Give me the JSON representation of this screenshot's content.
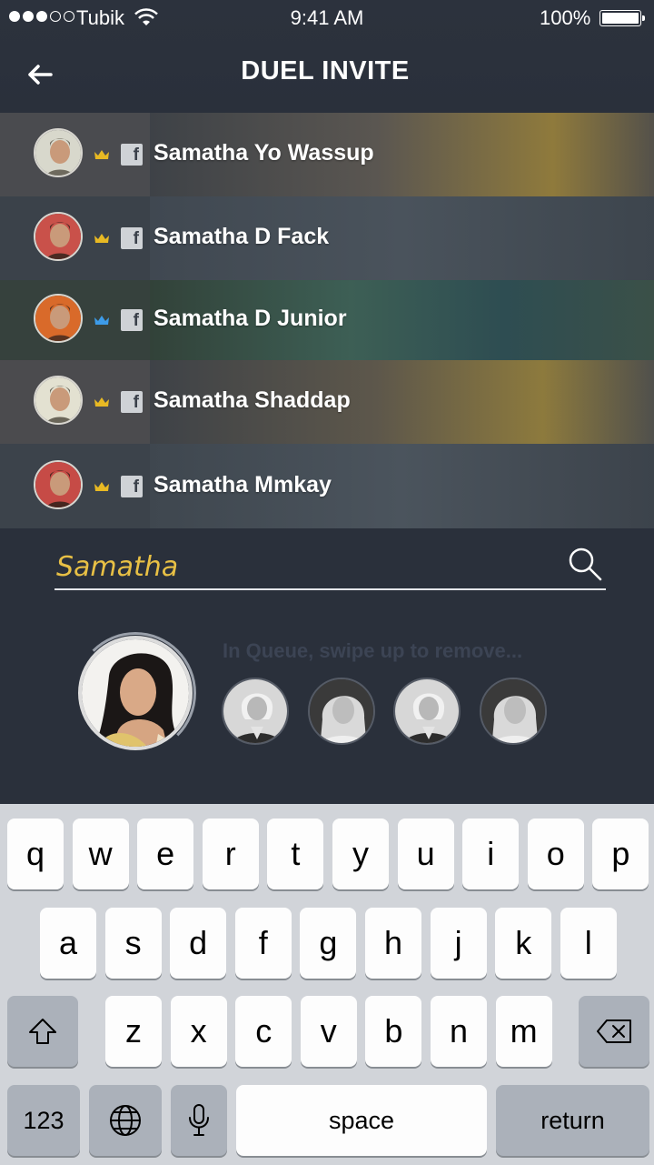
{
  "status_bar": {
    "carrier": "Tubik",
    "time": "9:41 AM",
    "battery": "100%"
  },
  "header": {
    "title": "DUEL INVITE"
  },
  "contacts": [
    {
      "name": "Samatha Yo Wassup",
      "crown_color": "#e8b923"
    },
    {
      "name": "Samatha D Fack",
      "crown_color": "#e8b923"
    },
    {
      "name": "Samatha D Junior",
      "crown_color": "#3d9be9"
    },
    {
      "name": "Samatha Shaddap",
      "crown_color": "#e8b923"
    },
    {
      "name": "Samatha Mmkay",
      "crown_color": "#e8b923"
    }
  ],
  "fb_badge_glyph": "f",
  "search": {
    "value": "Samatha"
  },
  "queue": {
    "hint": "In Queue, swipe up to remove..."
  },
  "keyboard": {
    "row1": [
      "q",
      "w",
      "e",
      "r",
      "t",
      "y",
      "u",
      "i",
      "o",
      "p"
    ],
    "row2": [
      "a",
      "s",
      "d",
      "f",
      "g",
      "h",
      "j",
      "k",
      "l"
    ],
    "row3": [
      "z",
      "x",
      "c",
      "v",
      "b",
      "n",
      "m"
    ],
    "numbers_label": "123",
    "space_label": "space",
    "return_label": "return"
  },
  "colors": {
    "accent": "#e8c045",
    "background": "#272d38"
  }
}
